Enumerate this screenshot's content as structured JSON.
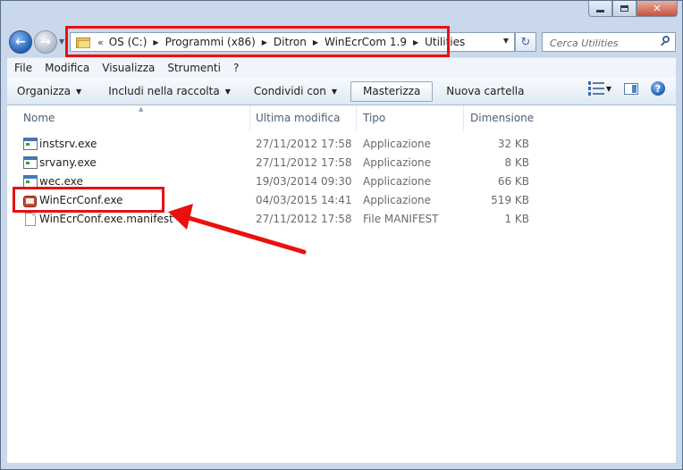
{
  "window": {
    "caption_buttons": {
      "minimize": "minimize-icon",
      "maximize": "maximize-icon",
      "close": "✕"
    }
  },
  "nav": {
    "back_icon": "back-arrow-icon",
    "forward_icon": "forward-arrow-icon"
  },
  "address": {
    "overflow": "«",
    "crumbs": [
      "OS (C:)",
      "Programmi (x86)",
      "Ditron",
      "WinEcrCom 1.9",
      "Utilities"
    ]
  },
  "search": {
    "placeholder": "Cerca Utilities"
  },
  "menu": [
    "File",
    "Modifica",
    "Visualizza",
    "Strumenti",
    "?"
  ],
  "commands": {
    "organize": "Organizza",
    "include": "Includi nella raccolta",
    "share": "Condividi con",
    "burn": "Masterizza",
    "new_folder": "Nuova cartella"
  },
  "columns": {
    "name": "Nome",
    "modified": "Ultima modifica",
    "type": "Tipo",
    "size": "Dimensione"
  },
  "files": [
    {
      "name": "instsrv.exe",
      "modified": "27/11/2012 17:58",
      "type": "Applicazione",
      "size": "32 KB",
      "icon": "exe-icon"
    },
    {
      "name": "srvany.exe",
      "modified": "27/11/2012 17:58",
      "type": "Applicazione",
      "size": "8 KB",
      "icon": "exe-icon"
    },
    {
      "name": "wec.exe",
      "modified": "19/03/2014 09:30",
      "type": "Applicazione",
      "size": "66 KB",
      "icon": "exe-icon"
    },
    {
      "name": "WinEcrConf.exe",
      "modified": "04/03/2015 14:41",
      "type": "Applicazione",
      "size": "519 KB",
      "icon": "app-icon"
    },
    {
      "name": "WinEcrConf.exe.manifest",
      "modified": "27/11/2012 17:58",
      "type": "File MANIFEST",
      "size": "1 KB",
      "icon": "document-icon"
    }
  ],
  "annotation": {
    "color": "#ea1010"
  }
}
